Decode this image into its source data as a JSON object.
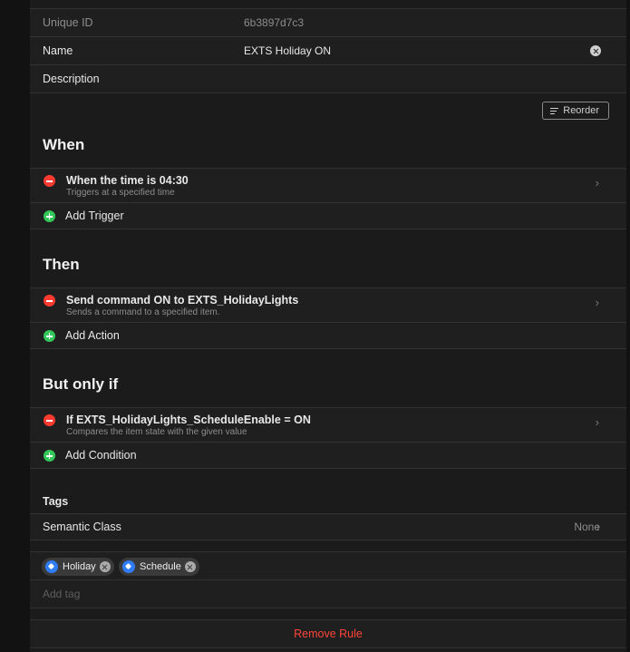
{
  "properties": {
    "uid_label": "Unique ID",
    "uid_value": "6b3897d7c3",
    "name_label": "Name",
    "name_value": "EXTS Holiday ON",
    "description_label": "Description"
  },
  "reorder_label": "Reorder",
  "when": {
    "title": "When",
    "item_title": "When the time is 04:30",
    "item_subtitle": "Triggers at a specified time",
    "add_label": "Add Trigger"
  },
  "then": {
    "title": "Then",
    "item_title": "Send command ON to EXTS_HolidayLights",
    "item_subtitle": "Sends a command to a specified item.",
    "add_label": "Add Action"
  },
  "conditions": {
    "title": "But only if",
    "item_title": "If EXTS_HolidayLights_ScheduleEnable = ON",
    "item_subtitle": "Compares the item state with the given value",
    "add_label": "Add Condition"
  },
  "tags": {
    "title": "Tags",
    "semantic_label": "Semantic Class",
    "semantic_value": "None",
    "chips": [
      "Holiday",
      "Schedule"
    ],
    "add_placeholder": "Add tag"
  },
  "remove_label": "Remove Rule",
  "colors": {
    "remove": "#ff453a",
    "minus": "#ff3b30",
    "plus": "#34c759",
    "tag": "#2f7cf6"
  }
}
